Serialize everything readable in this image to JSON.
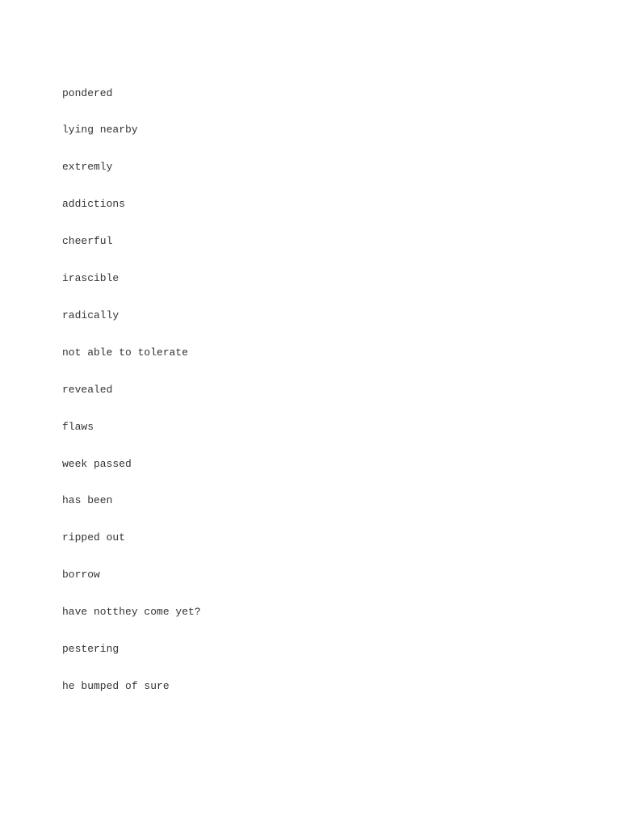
{
  "document": {
    "lines": [
      "pondered",
      "lying nearby",
      "extremly",
      "addictions",
      "cheerful",
      "irascible",
      "radically",
      "not able to tolerate",
      "revealed",
      "flaws",
      "week passed",
      "has been",
      "ripped out",
      "borrow",
      "have notthey come yet?",
      "pestering",
      "he bumped of sure"
    ]
  }
}
